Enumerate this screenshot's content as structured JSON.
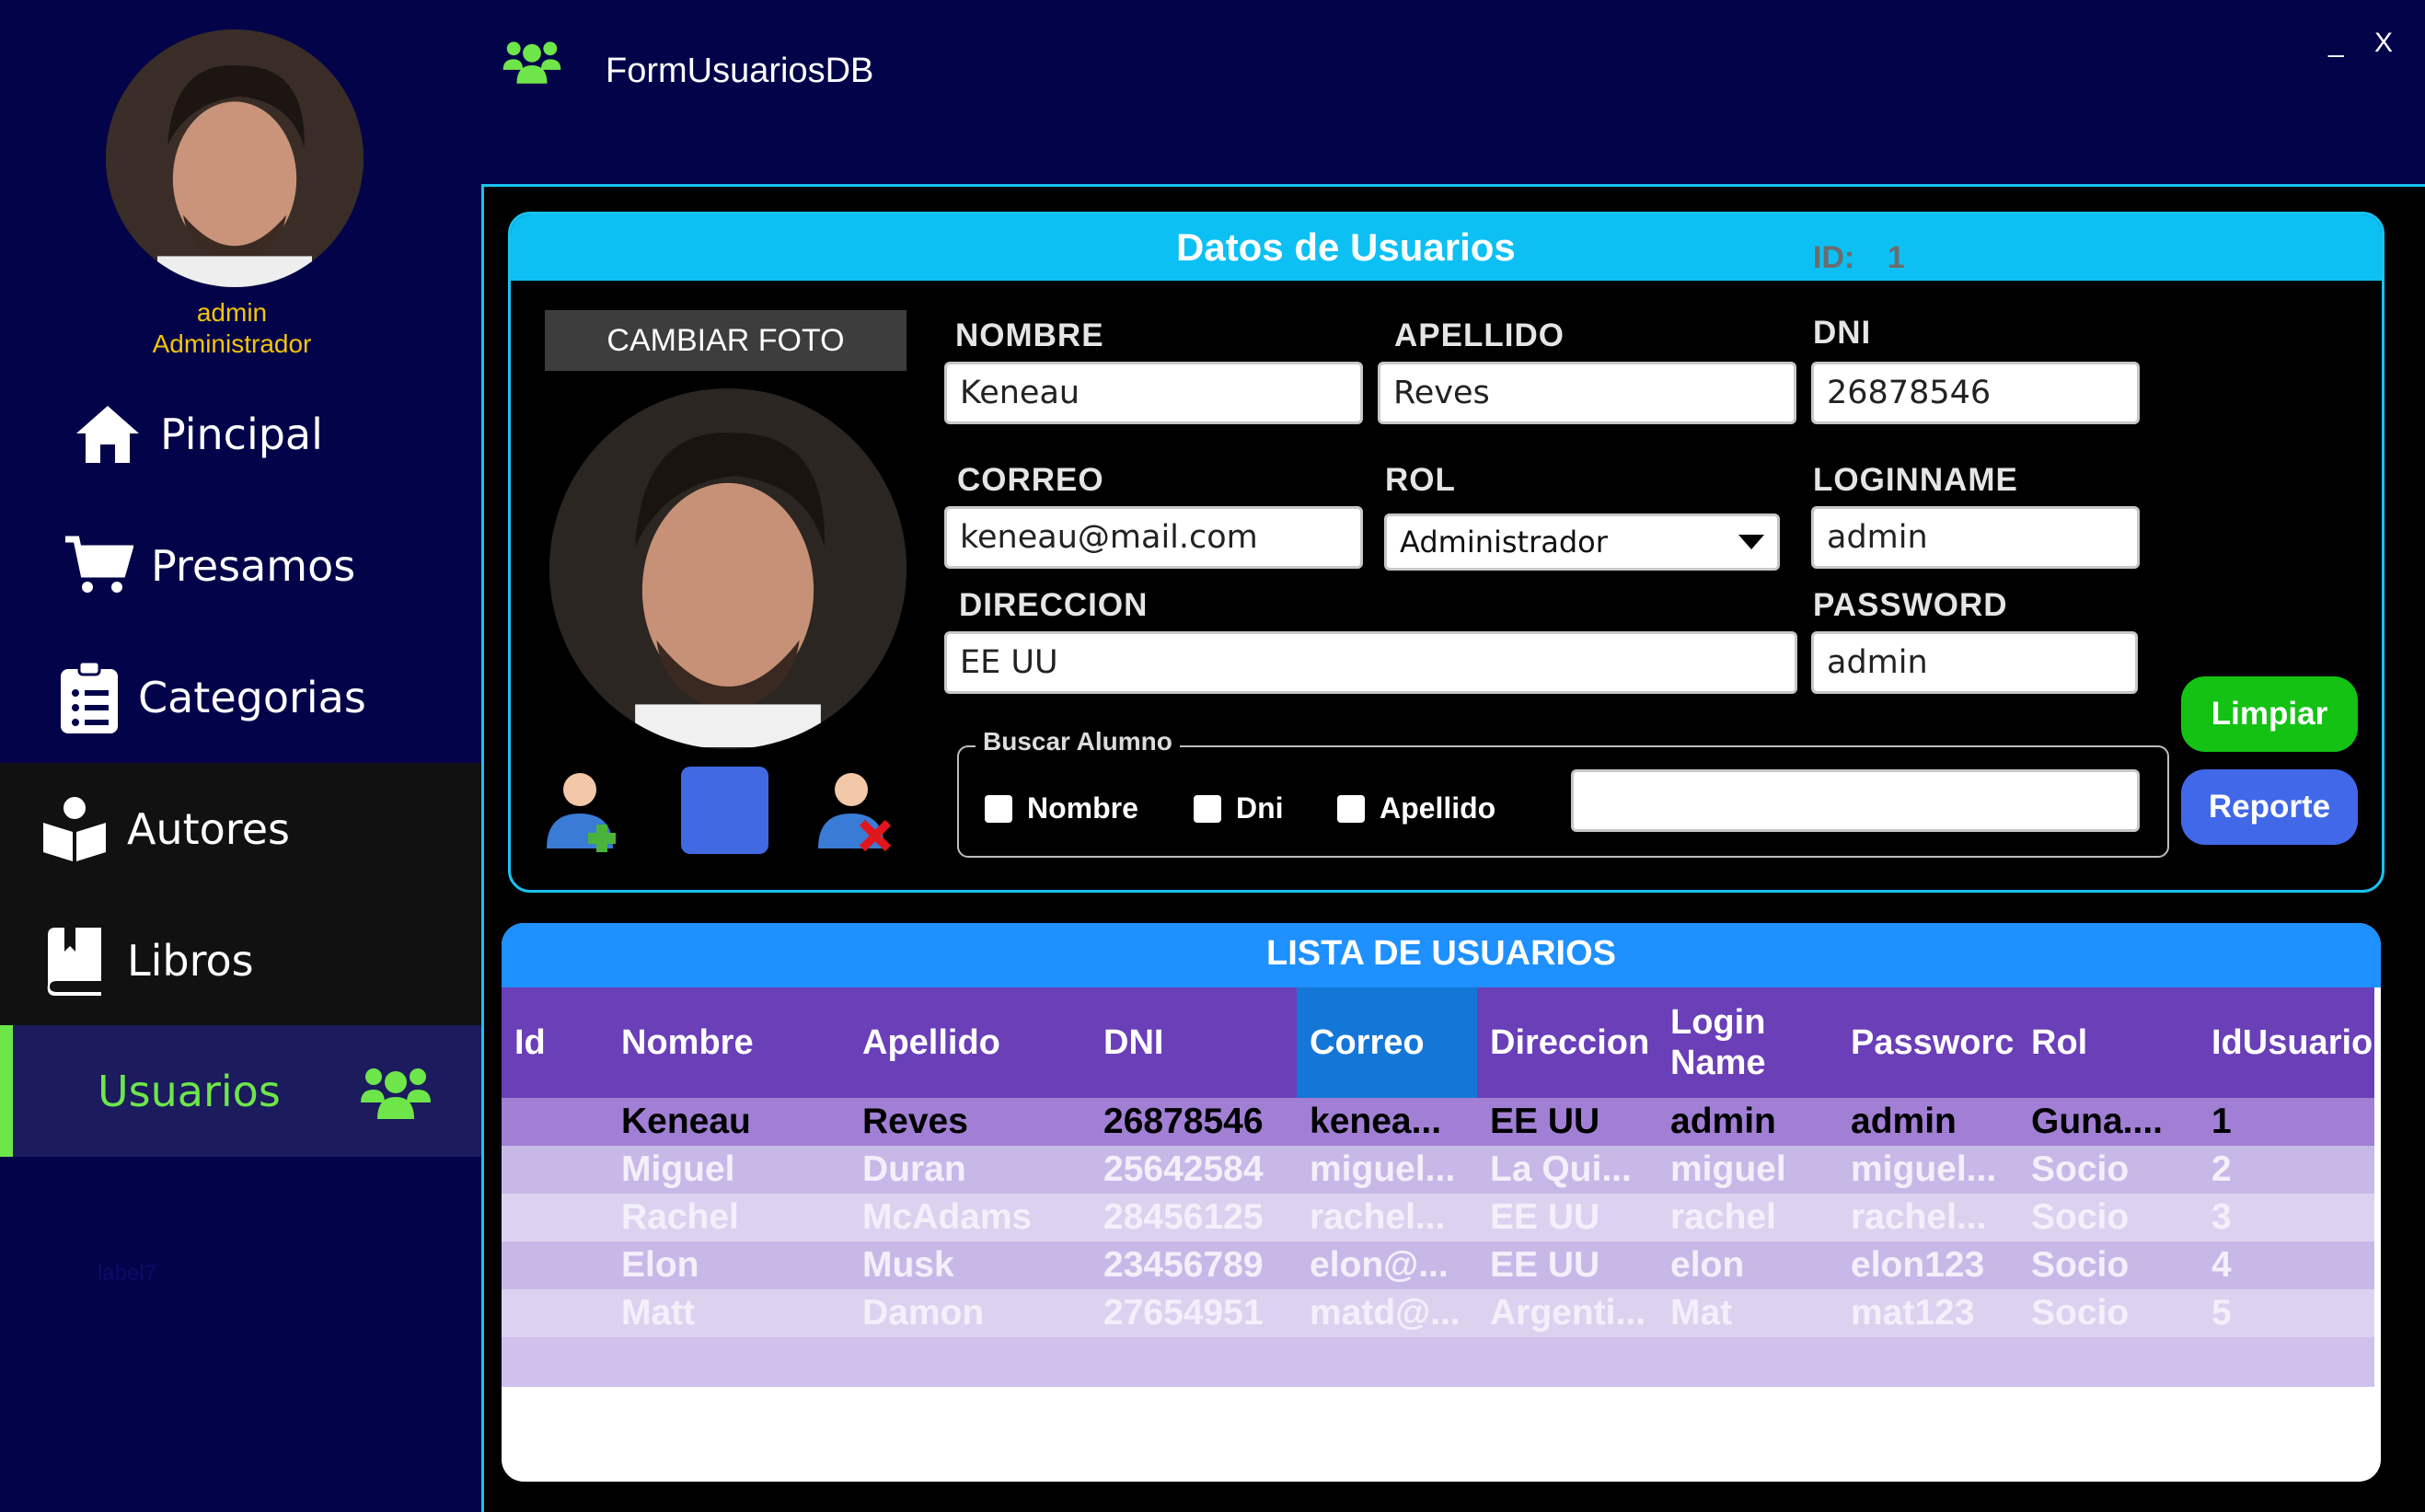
{
  "window": {
    "title": "FormUsuariosDB",
    "minimize": "_",
    "close": "X"
  },
  "user": {
    "name": "admin",
    "role": "Administrador"
  },
  "sidebar": {
    "items": [
      {
        "label": "Pincipal",
        "icon": "home-icon"
      },
      {
        "label": "Presamos",
        "icon": "cart-icon"
      },
      {
        "label": "Categorias",
        "icon": "clipboard-icon"
      },
      {
        "label": "Autores",
        "icon": "reader-icon"
      },
      {
        "label": "Libros",
        "icon": "book-icon"
      },
      {
        "label": "Usuarios",
        "icon": "users-icon"
      }
    ],
    "footer_label": "label7"
  },
  "form": {
    "title": "Datos de Usuarios",
    "id_label": "ID:",
    "id_value": "1",
    "change_photo": "CAMBIAR FOTO",
    "fields": {
      "nombre": {
        "label": "NOMBRE",
        "value": "Keneau"
      },
      "apellido": {
        "label": "APELLIDO",
        "value": "Reves"
      },
      "dni": {
        "label": "DNI",
        "value": "26878546"
      },
      "correo": {
        "label": "CORREO",
        "value": "keneau@mail.com"
      },
      "rol": {
        "label": "ROL",
        "value": "Administrador"
      },
      "loginname": {
        "label": "LOGINNAME",
        "value": "admin"
      },
      "direccion": {
        "label": "DIRECCION",
        "value": "EE UU"
      },
      "password": {
        "label": "PASSWORD",
        "value": "admin"
      }
    },
    "search": {
      "legend": "Buscar Alumno",
      "opt_nombre": "Nombre",
      "opt_dni": "Dni",
      "opt_apellido": "Apellido",
      "value": ""
    },
    "btn_limpiar": "Limpiar",
    "btn_reporte": "Reporte"
  },
  "table": {
    "title": "LISTA DE USUARIOS",
    "columns": [
      "Id",
      "Nombre",
      "Apellido",
      "DNI",
      "Correo",
      "Direccion",
      "Login\nName",
      "Passworc",
      "Rol",
      "IdUsuario"
    ],
    "rows": [
      [
        "",
        "Keneau",
        "Reves",
        "26878546",
        "kenea...",
        "EE UU",
        "admin",
        "admin",
        "Guna....",
        "1"
      ],
      [
        "",
        "Miguel",
        "Duran",
        "25642584",
        "miguel...",
        "La Qui...",
        "miguel",
        "miguel...",
        "Socio",
        "2"
      ],
      [
        "",
        "Rachel",
        "McAdams",
        "28456125",
        "rachel...",
        "EE UU",
        "rachel",
        "rachel...",
        "Socio",
        "3"
      ],
      [
        "",
        "Elon",
        "Musk",
        "23456789",
        "elon@...",
        "EE UU",
        "elon",
        "elon123",
        "Socio",
        "4"
      ],
      [
        "",
        "Matt",
        "Damon",
        "27654951",
        "matd@...",
        "Argenti...",
        "Mat",
        "mat123",
        "Socio",
        "5"
      ]
    ]
  },
  "colors": {
    "background": "#03034a",
    "accent_green": "#6ee64a",
    "header_blue": "#0cc0f4",
    "table_header": "#6a3fb8",
    "selected_column": "#1477d8"
  }
}
